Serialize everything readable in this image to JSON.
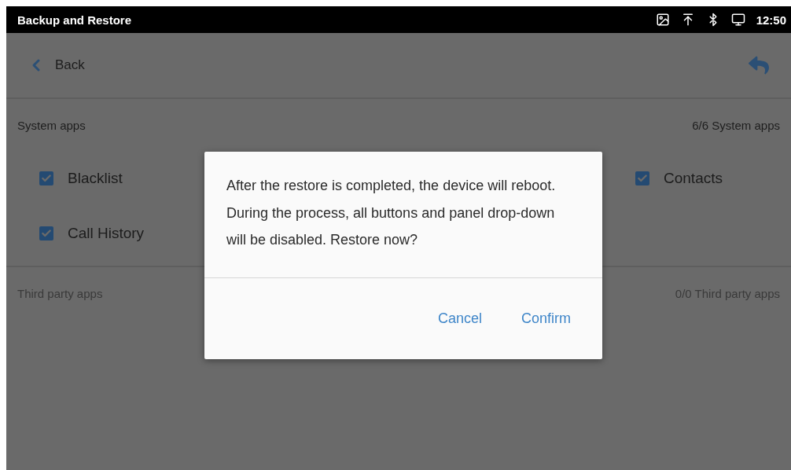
{
  "status_bar": {
    "title": "Backup and Restore",
    "time": "12:50"
  },
  "header": {
    "back_label": "Back"
  },
  "system_apps": {
    "label": "System apps",
    "count": "6/6  System apps",
    "items": [
      {
        "label": "Blacklist",
        "checked": true
      },
      {
        "label": "Contacts",
        "checked": true
      },
      {
        "label": "Call History",
        "checked": true
      }
    ]
  },
  "third_party_apps": {
    "label": "Third party apps",
    "count": "0/0  Third party apps"
  },
  "dialog": {
    "message": "After the restore is completed, the device will reboot. During the process, all buttons and panel drop-down will be disabled. Restore now?",
    "buttons": [
      "Cancel",
      "Confirm"
    ]
  }
}
